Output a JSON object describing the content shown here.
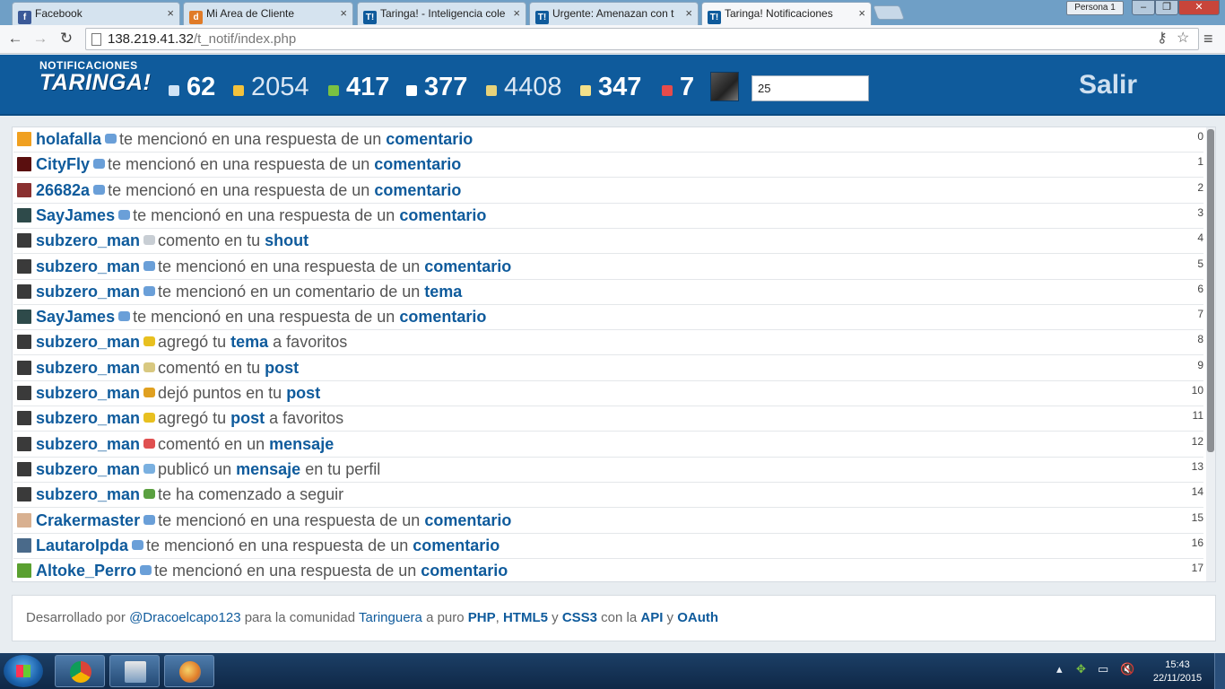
{
  "browser": {
    "tabs": [
      {
        "title": "Facebook",
        "favicon": "f",
        "color": "#3b5998",
        "active": false
      },
      {
        "title": "Mi Area de Cliente",
        "favicon": "d",
        "color": "#e07b28",
        "active": false
      },
      {
        "title": "Taringa! - Inteligencia cole",
        "favicon": "T!",
        "color": "#0f5b9c",
        "active": false
      },
      {
        "title": "Urgente: Amenazan con t",
        "favicon": "T!",
        "color": "#0f5b9c",
        "active": false
      },
      {
        "title": "Taringa! Notificaciones",
        "favicon": "T!",
        "color": "#0f5b9c",
        "active": true
      }
    ],
    "profile": "Persona 1",
    "url_host": "138.219.41.32",
    "url_path": "/t_notif/index.php"
  },
  "header": {
    "brand_sub": "NOTIFICACIONES",
    "brand_main": "TARINGA!",
    "stats": [
      {
        "value": "62",
        "icon": "posts-icon",
        "color": "#cfe3f5",
        "weight": "bold"
      },
      {
        "value": "2054",
        "icon": "points-icon",
        "color": "#f3c23c",
        "weight": "light"
      },
      {
        "value": "417",
        "icon": "followers-icon",
        "color": "#7ac142",
        "weight": "bold"
      },
      {
        "value": "377",
        "icon": "eye-icon",
        "color": "#ffffff",
        "weight": "bold"
      },
      {
        "value": "4408",
        "icon": "comments-icon",
        "color": "#e6d27a",
        "weight": "light"
      },
      {
        "value": "347",
        "icon": "messages-icon",
        "color": "#f2e08a",
        "weight": "bold"
      },
      {
        "value": "7",
        "icon": "flag-icon",
        "color": "#e64b4b",
        "weight": "bold"
      }
    ],
    "count_value": "25",
    "logout_label": "Salir"
  },
  "notifications": [
    {
      "user": "holafalla",
      "avatar_color": "#f0a020",
      "icon": "mention-icon",
      "icon_color": "#6a9fd8",
      "pre": "te mencionó en una respuesta de un",
      "target": "comentario",
      "post": "",
      "index": "0"
    },
    {
      "user": "CityFly",
      "avatar_color": "#5a0f0f",
      "icon": "mention-icon",
      "icon_color": "#6a9fd8",
      "pre": "te mencionó en una respuesta de un",
      "target": "comentario",
      "post": "",
      "index": "1"
    },
    {
      "user": "26682a",
      "avatar_color": "#8a3030",
      "icon": "mention-icon",
      "icon_color": "#6a9fd8",
      "pre": "te mencionó en una respuesta de un",
      "target": "comentario",
      "post": "",
      "index": "2"
    },
    {
      "user": "SayJames",
      "avatar_color": "#2e4a4a",
      "icon": "mention-icon",
      "icon_color": "#6a9fd8",
      "pre": "te mencionó en una respuesta de un",
      "target": "comentario",
      "post": "",
      "index": "3"
    },
    {
      "user": "subzero_man",
      "avatar_color": "#3a3a3a",
      "icon": "shout-icon",
      "icon_color": "#c8ced4",
      "pre": "comento en tu",
      "target": "shout",
      "post": "",
      "index": "4"
    },
    {
      "user": "subzero_man",
      "avatar_color": "#3a3a3a",
      "icon": "mention-icon",
      "icon_color": "#6a9fd8",
      "pre": "te mencionó en una respuesta de un",
      "target": "comentario",
      "post": "",
      "index": "5"
    },
    {
      "user": "subzero_man",
      "avatar_color": "#3a3a3a",
      "icon": "mention-icon",
      "icon_color": "#6a9fd8",
      "pre": "te mencionó en un comentario de un",
      "target": "tema",
      "post": "",
      "index": "6"
    },
    {
      "user": "SayJames",
      "avatar_color": "#2e4a4a",
      "icon": "mention-icon",
      "icon_color": "#6a9fd8",
      "pre": "te mencionó en una respuesta de un",
      "target": "comentario",
      "post": "",
      "index": "7"
    },
    {
      "user": "subzero_man",
      "avatar_color": "#3a3a3a",
      "icon": "favorite-icon",
      "icon_color": "#e8c020",
      "pre": "agregó tu",
      "target": "tema",
      "post": "a favoritos",
      "index": "8"
    },
    {
      "user": "subzero_man",
      "avatar_color": "#3a3a3a",
      "icon": "comment-icon",
      "icon_color": "#d8c880",
      "pre": "comentó en tu",
      "target": "post",
      "post": "",
      "index": "9"
    },
    {
      "user": "subzero_man",
      "avatar_color": "#3a3a3a",
      "icon": "points-icon",
      "icon_color": "#e0a020",
      "pre": "dejó puntos en tu",
      "target": "post",
      "post": "",
      "index": "10"
    },
    {
      "user": "subzero_man",
      "avatar_color": "#3a3a3a",
      "icon": "favorite-icon",
      "icon_color": "#e8c020",
      "pre": "agregó tu",
      "target": "post",
      "post": "a favoritos",
      "index": "11"
    },
    {
      "user": "subzero_man",
      "avatar_color": "#3a3a3a",
      "icon": "message-icon",
      "icon_color": "#e05050",
      "pre": "comentó en un",
      "target": "mensaje",
      "post": "",
      "index": "12"
    },
    {
      "user": "subzero_man",
      "avatar_color": "#3a3a3a",
      "icon": "wall-icon",
      "icon_color": "#7ab0e0",
      "pre": "publicó un",
      "target": "mensaje",
      "post": "en tu perfil",
      "index": "13"
    },
    {
      "user": "subzero_man",
      "avatar_color": "#3a3a3a",
      "icon": "follow-icon",
      "icon_color": "#5aa040",
      "pre": "te ha comenzado a seguir",
      "target": "",
      "post": "",
      "index": "14"
    },
    {
      "user": "Crakermaster",
      "avatar_color": "#d8b090",
      "icon": "mention-icon",
      "icon_color": "#6a9fd8",
      "pre": "te mencionó en una respuesta de un",
      "target": "comentario",
      "post": "",
      "index": "15"
    },
    {
      "user": "LautaroIpda",
      "avatar_color": "#4a6a8a",
      "icon": "mention-icon",
      "icon_color": "#6a9fd8",
      "pre": "te mencionó en una respuesta de un",
      "target": "comentario",
      "post": "",
      "index": "16"
    },
    {
      "user": "Altoke_Perro",
      "avatar_color": "#5aa030",
      "icon": "mention-icon",
      "icon_color": "#6a9fd8",
      "pre": "te mencionó en una respuesta de un",
      "target": "comentario",
      "post": "",
      "index": "17"
    }
  ],
  "footer": {
    "t1": "Desarrollado por ",
    "author": "@Dracoelcapo123",
    "t2": " para la comunidad ",
    "community": "Taringuera",
    "t3": " a puro ",
    "php": "PHP",
    "t4": ", ",
    "html5": "HTML5",
    "t5": " y ",
    "css3": "CSS3",
    "t6": " con la ",
    "api": "API",
    "t7": " y ",
    "oauth": "OAuth"
  },
  "taskbar": {
    "time": "15:43",
    "date": "22/11/2015"
  }
}
